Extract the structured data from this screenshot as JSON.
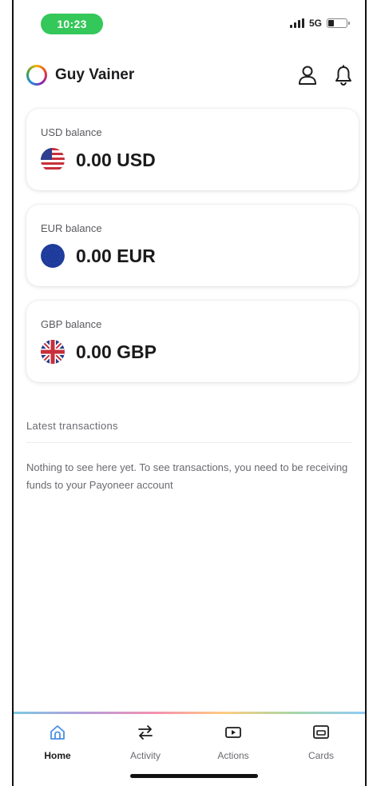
{
  "status_bar": {
    "time": "10:23",
    "network": "5G"
  },
  "header": {
    "user_name": "Guy Vainer",
    "icons": [
      "profile-icon",
      "bell-icon"
    ]
  },
  "balances": [
    {
      "label": "USD balance",
      "amount": "0.00 USD",
      "flag": "us-flag-icon"
    },
    {
      "label": "EUR balance",
      "amount": "0.00 EUR",
      "flag": "eu-flag-icon"
    },
    {
      "label": "GBP balance",
      "amount": "0.00 GBP",
      "flag": "uk-flag-icon"
    }
  ],
  "transactions": {
    "title": "Latest transactions",
    "empty_message": "Nothing to see here yet. To see transactions, you need to be receiving funds to your Payoneer account"
  },
  "bottom_nav": {
    "items": [
      {
        "label": "Home",
        "icon": "home-icon",
        "active": true
      },
      {
        "label": "Activity",
        "icon": "transfer-arrows-icon",
        "active": false
      },
      {
        "label": "Actions",
        "icon": "actions-icon",
        "active": false
      },
      {
        "label": "Cards",
        "icon": "cards-icon",
        "active": false
      }
    ]
  },
  "colors": {
    "time_pill": "#34c759",
    "home_active": "#4a90e2",
    "eu_flag": "#1f3c9c"
  }
}
